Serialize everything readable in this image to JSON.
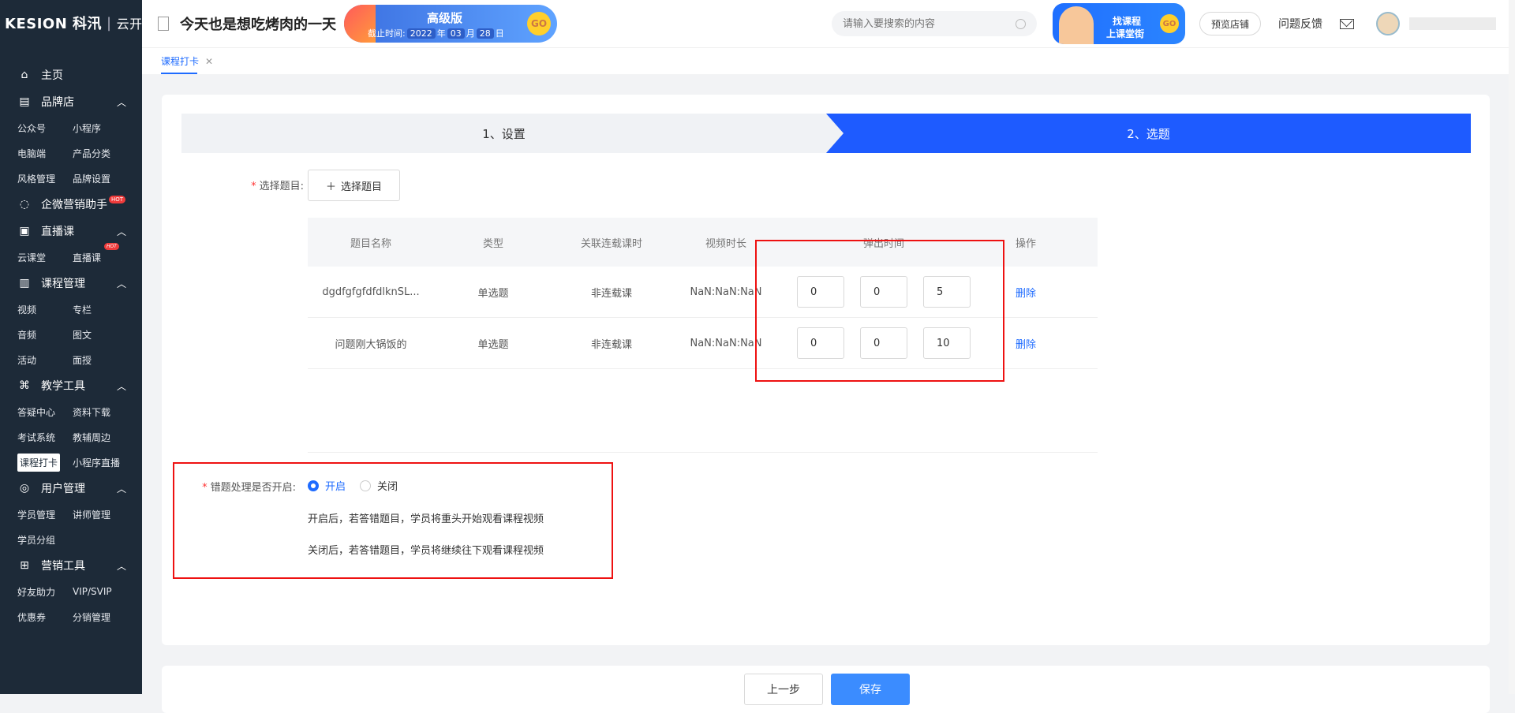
{
  "brand": {
    "logo": "KESION 科汛",
    "sub": "云开店"
  },
  "header": {
    "site_title": "今天也是想吃烤肉的一天",
    "edition": {
      "name": "高级版",
      "expire_label": "截止时间:",
      "year": "2022",
      "year_unit": "年",
      "month": "03",
      "month_unit": "月",
      "day": "28",
      "day_unit": "日",
      "go": "GO"
    },
    "search_placeholder": "请输入要搜索的内容",
    "promo": {
      "line1": "找课程",
      "line2": "上课堂街",
      "go": "GO"
    },
    "preview_store": "预览店铺",
    "feedback": "问题反馈"
  },
  "sidebar": {
    "home": "主页",
    "groups": [
      {
        "title": "品牌店",
        "items": [
          "公众号",
          "小程序",
          "电脑端",
          "产品分类",
          "风格管理",
          "品牌设置"
        ]
      },
      {
        "title": "企微营销助手",
        "hot": "HOT",
        "items": []
      },
      {
        "title": "直播课",
        "items": [
          "云课堂",
          "直播课"
        ],
        "hot_item": "HOT"
      },
      {
        "title": "课程管理",
        "items": [
          "视频",
          "专栏",
          "音频",
          "图文",
          "活动",
          "面授"
        ]
      },
      {
        "title": "教学工具",
        "items": [
          "答疑中心",
          "资料下载",
          "考试系统",
          "教辅周边",
          "课程打卡",
          "小程序直播"
        ]
      },
      {
        "title": "用户管理",
        "items": [
          "学员管理",
          "讲师管理",
          "学员分组"
        ]
      },
      {
        "title": "营销工具",
        "items": [
          "好友助力",
          "VIP/SVIP",
          "优惠券",
          "分销管理"
        ]
      }
    ],
    "active_item": "课程打卡"
  },
  "tabs": [
    {
      "label": "课程打卡"
    }
  ],
  "steps": [
    {
      "label": "1、设置"
    },
    {
      "label": "2、选题"
    }
  ],
  "form": {
    "select_label": "选择题目:",
    "select_button": "选择题目",
    "table": {
      "headers": [
        "题目名称",
        "类型",
        "关联连载课时",
        "视频时长",
        "弹出时间",
        "操作"
      ],
      "rows": [
        {
          "name": "dgdfgfgfdfdlknSL...",
          "type": "单选题",
          "linked": "非连载课",
          "duration": "NaN:NaN:NaN",
          "h": "0",
          "m": "0",
          "s": "5",
          "action": "删除"
        },
        {
          "name": "问题刚大锅饭的",
          "type": "单选题",
          "linked": "非连载课",
          "duration": "NaN:NaN:NaN",
          "h": "0",
          "m": "0",
          "s": "10",
          "action": "删除"
        }
      ]
    },
    "wrong_label": "错题处理是否开启:",
    "option_on": "开启",
    "option_off": "关闭",
    "note_on": "开启后，若答错题目，学员将重头开始观看课程视频",
    "note_off": "关闭后，若答错题目，学员将继续往下观看课程视频"
  },
  "footer": {
    "prev": "上一步",
    "save": "保存"
  },
  "colors": {
    "primary": "#1e5bff",
    "sidebar": "#1d2a38",
    "highlight": "#e11111"
  }
}
